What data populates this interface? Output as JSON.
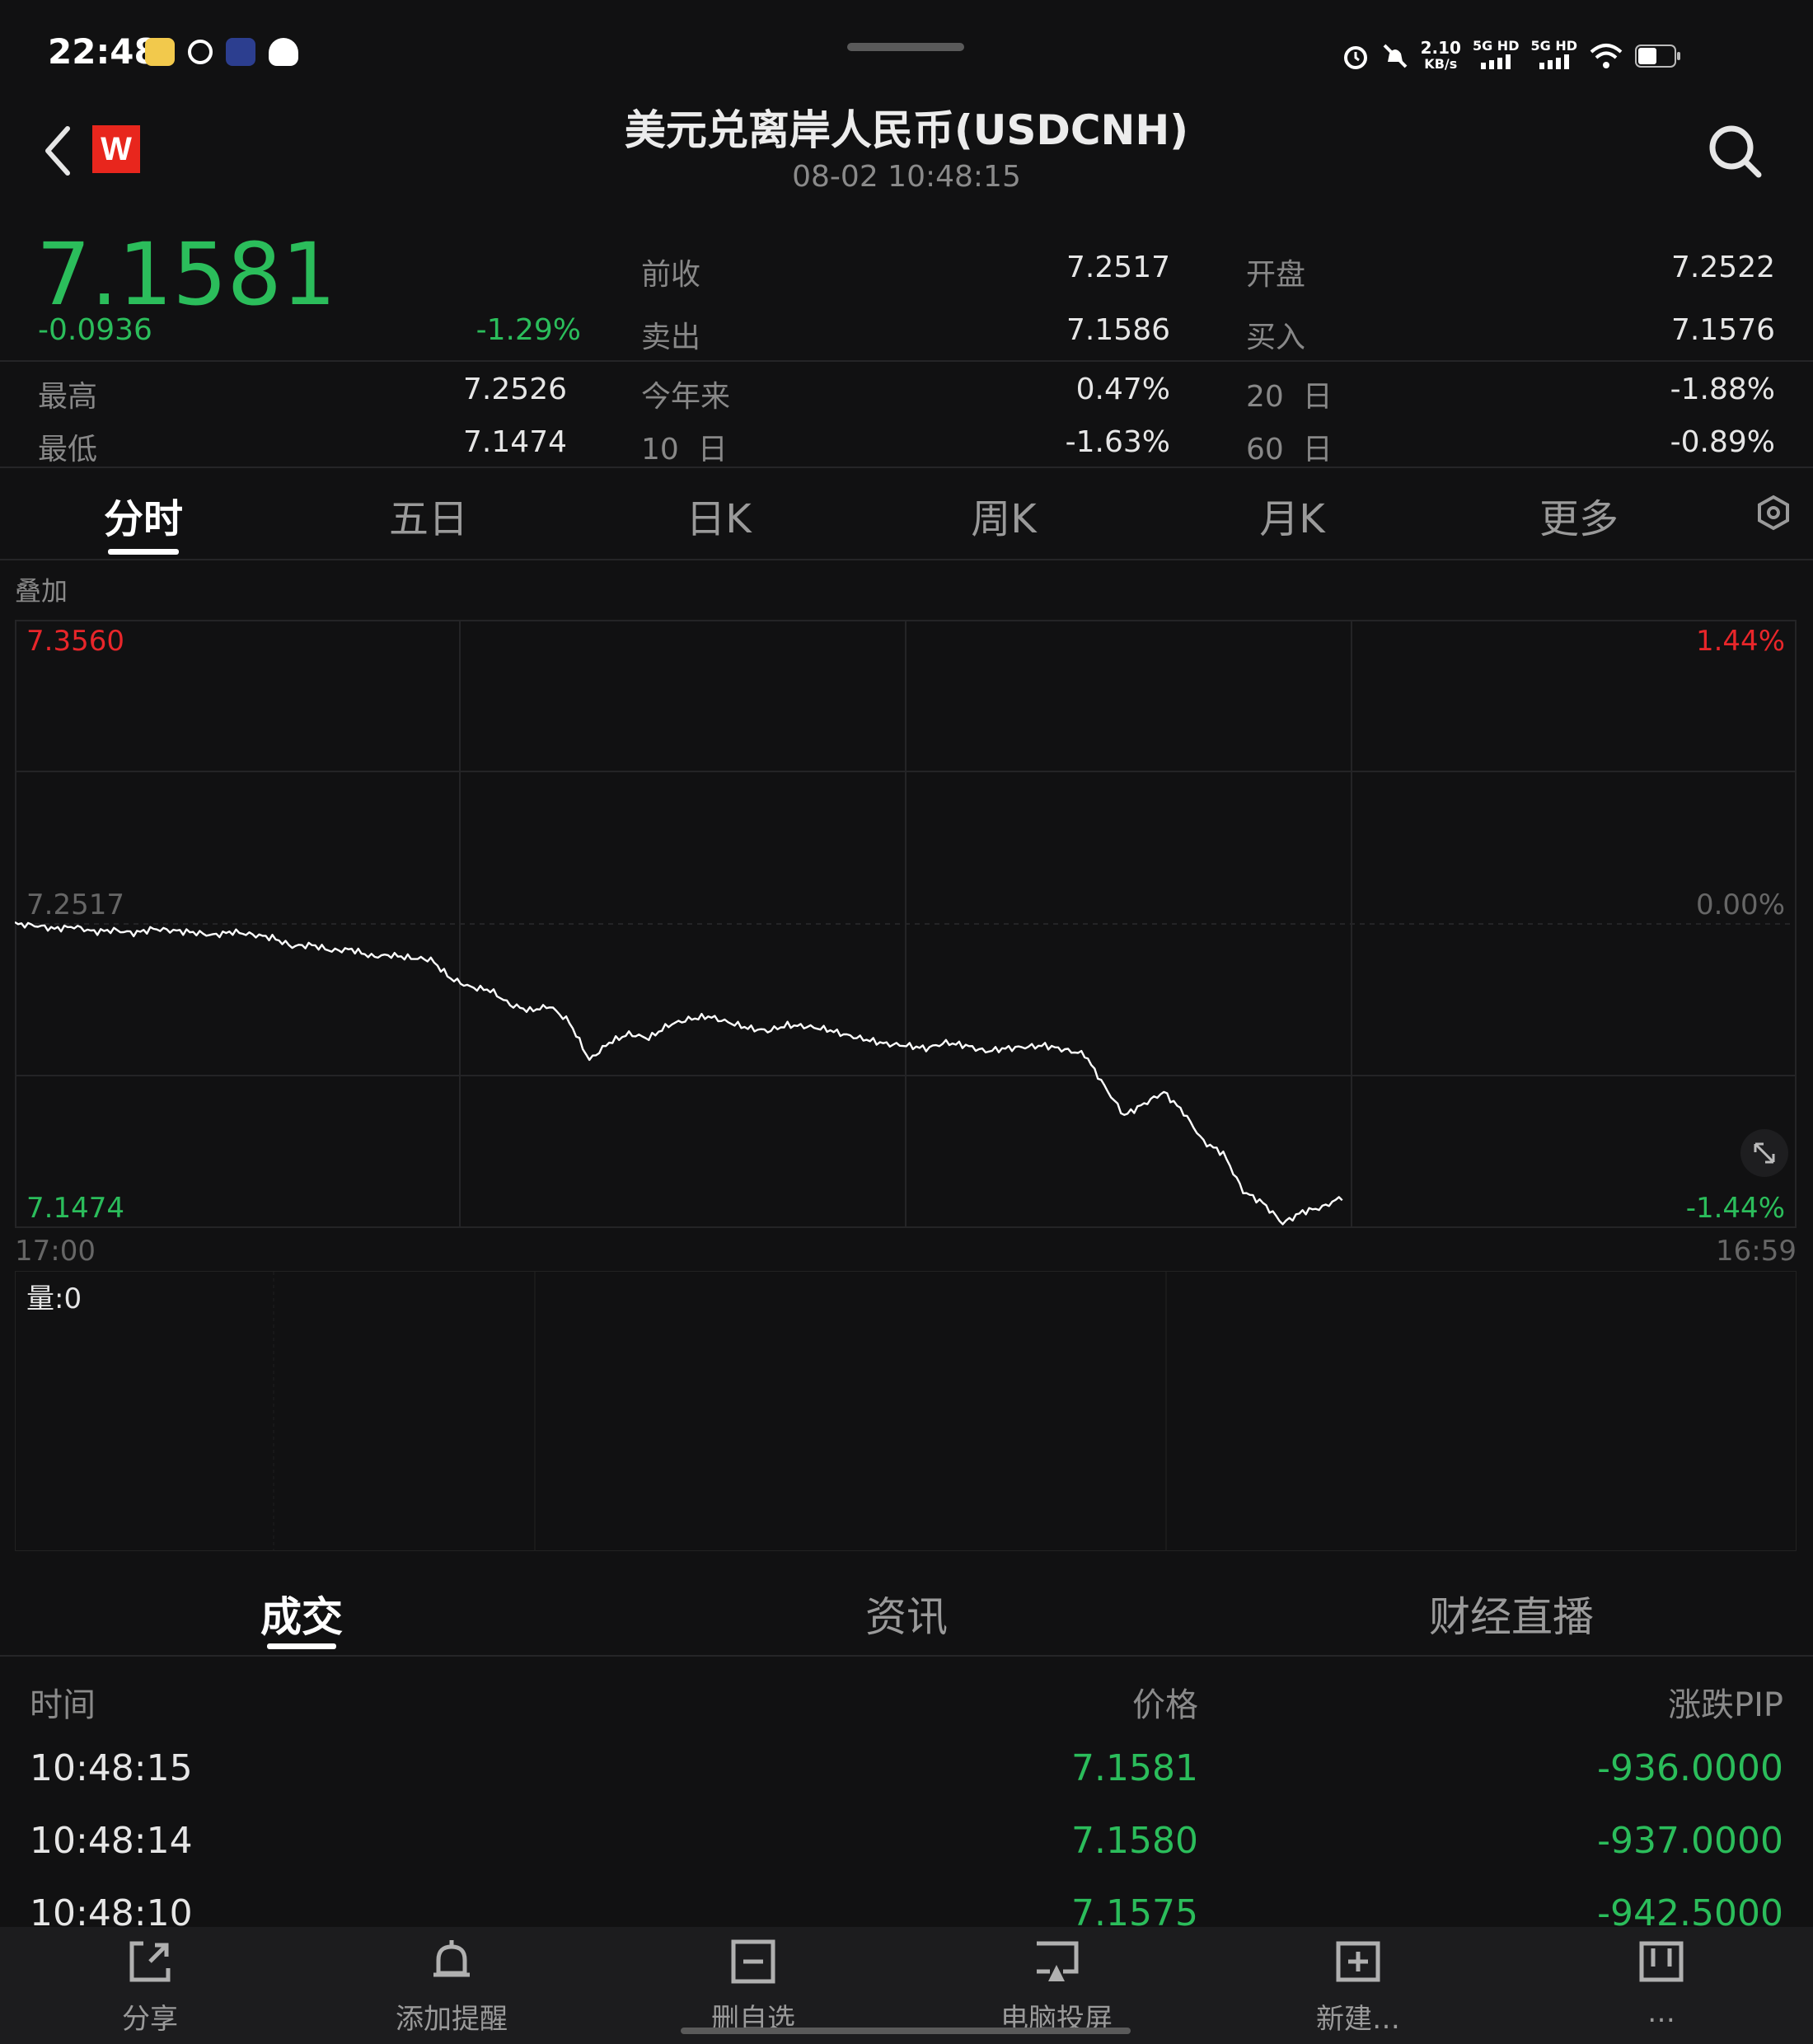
{
  "status": {
    "time": "22:48",
    "net_speed_value": "2.10",
    "net_speed_unit": "KB/s",
    "sim1": "5G HD",
    "sim2": "5G HD"
  },
  "header": {
    "logo_letter": "W",
    "title": "美元兑离岸人民币(USDCNH)",
    "timestamp": "08-02 10:48:15"
  },
  "quote": {
    "price": "7.1581",
    "change": "-0.0936",
    "change_pct": "-1.29%",
    "stats": {
      "prev_close_label": "前收",
      "prev_close": "7.2517",
      "open_label": "开盘",
      "open": "7.2522",
      "ask_label": "卖出",
      "ask": "7.1586",
      "bid_label": "买入",
      "bid": "7.1576",
      "high_label": "最高",
      "high": "7.2526",
      "ytd_label": "今年来",
      "ytd": "0.47%",
      "d20_num": "20",
      "d20_unit": "日",
      "d20": "-1.88%",
      "low_label": "最低",
      "low": "7.1474",
      "d10_num": "10",
      "d10_unit": "日",
      "d10": "-1.63%",
      "d60_num": "60",
      "d60_unit": "日",
      "d60": "-0.89%"
    }
  },
  "tabs": [
    "分时",
    "五日",
    "日K",
    "周K",
    "月K",
    "更多"
  ],
  "chart": {
    "overlay_label": "叠加",
    "y_top": "7.3560",
    "y_mid": "7.2517",
    "y_bottom": "7.1474",
    "pct_top": "1.44%",
    "pct_mid": "0.00%",
    "pct_bottom": "-1.44%",
    "x_start": "17:00",
    "x_end": "16:59",
    "volume_label": "量:0",
    "colors": {
      "up": "#e8262a",
      "down": "#2bbd5b",
      "line": "#ffffff"
    }
  },
  "chart_data": {
    "type": "line",
    "x_range": [
      "17:00",
      "16:59"
    ],
    "ylim": [
      7.1474,
      7.356
    ],
    "reference": 7.2517,
    "series": [
      {
        "values": [
          7.2517,
          7.2512,
          7.25,
          7.2508,
          7.249,
          7.2496,
          7.2485,
          7.25,
          7.2494,
          7.2488,
          7.2478,
          7.249,
          7.248,
          7.247,
          7.244,
          7.2445,
          7.2425,
          7.243,
          7.2405,
          7.241,
          7.24,
          7.2395,
          7.233,
          7.23,
          7.229,
          7.224,
          7.222,
          7.2235,
          7.218,
          7.205,
          7.211,
          7.214,
          7.2125,
          7.217,
          7.219,
          7.22,
          7.218,
          7.216,
          7.215,
          7.217,
          7.2165,
          7.2155,
          7.2135,
          7.212,
          7.2105,
          7.21,
          7.209,
          7.211,
          7.21,
          7.208,
          7.209,
          7.2095,
          7.21,
          7.2085,
          7.207,
          7.196,
          7.186,
          7.19,
          7.194,
          7.187,
          7.177,
          7.173,
          7.16,
          7.156,
          7.149,
          7.153,
          7.1545,
          7.1581
        ]
      }
    ]
  },
  "lower_tabs": [
    "成交",
    "资讯",
    "财经直播"
  ],
  "trades": {
    "headers": [
      "时间",
      "价格",
      "涨跌PIP"
    ],
    "rows": [
      {
        "time": "10:48:15",
        "price": "7.1581",
        "pip": "-936.0000"
      },
      {
        "time": "10:48:14",
        "price": "7.1580",
        "pip": "-937.0000"
      },
      {
        "time": "10:48:10",
        "price": "7.1575",
        "pip": "-942.5000"
      }
    ]
  },
  "nav": [
    "分享",
    "添加提醒",
    "删自选",
    "电脑投屏",
    "新建…",
    "…"
  ]
}
